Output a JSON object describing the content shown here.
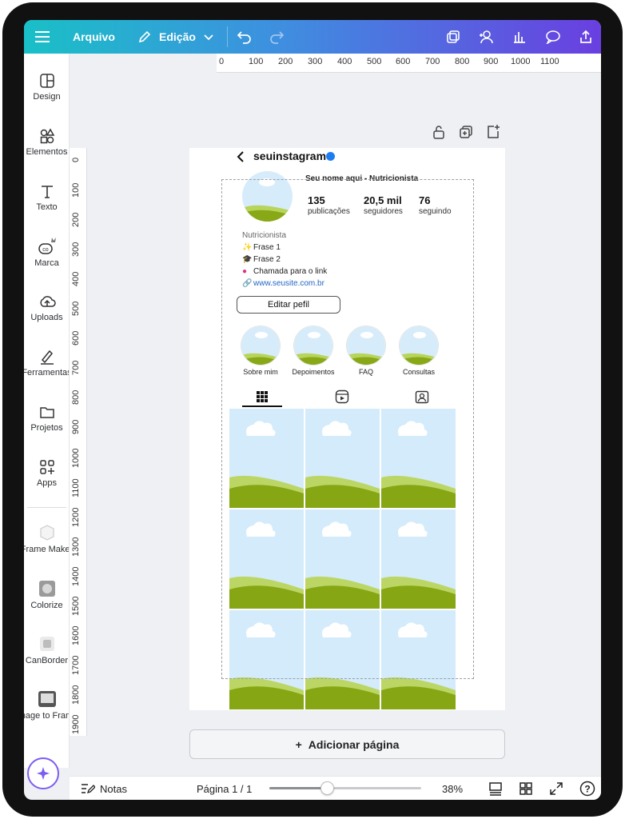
{
  "toolbar": {
    "file_label": "Arquivo",
    "edit_label": "Edição"
  },
  "sidebar": {
    "items": [
      {
        "label": "Design",
        "icon": "layout-icon"
      },
      {
        "label": "Elementos",
        "icon": "shapes-icon"
      },
      {
        "label": "Texto",
        "icon": "text-icon"
      },
      {
        "label": "Marca",
        "icon": "brand-icon"
      },
      {
        "label": "Uploads",
        "icon": "upload-cloud-icon"
      },
      {
        "label": "Ferramentas",
        "icon": "tools-icon"
      },
      {
        "label": "Projetos",
        "icon": "folder-icon"
      },
      {
        "label": "Apps",
        "icon": "apps-icon"
      },
      {
        "label": "Frame Maker",
        "icon": "frame-maker-icon"
      },
      {
        "label": "Colorize",
        "icon": "colorize-icon"
      },
      {
        "label": "CanBorder",
        "icon": "canborder-icon"
      },
      {
        "label": "Image to Frame",
        "icon": "image-to-frame-icon"
      }
    ]
  },
  "ruler": {
    "top": [
      "0",
      "100",
      "200",
      "300",
      "400",
      "500",
      "600",
      "700",
      "800",
      "900",
      "1000",
      "1100"
    ],
    "left": [
      "0",
      "100",
      "200",
      "300",
      "400",
      "500",
      "600",
      "700",
      "800",
      "900",
      "1000",
      "1100",
      "1200",
      "1300",
      "1400",
      "1500",
      "1600",
      "1700",
      "1800",
      "1900"
    ]
  },
  "profile": {
    "username": "seuinstagram",
    "name_line": "Seu nome aqui - Nutricionista",
    "stats": [
      {
        "value": "135",
        "label": "publicações"
      },
      {
        "value": "20,5 mil",
        "label": "seguidores"
      },
      {
        "value": "76",
        "label": "seguindo"
      }
    ],
    "bio": {
      "role": "Nutricionista",
      "line1": "Frase 1",
      "line2": "Frase 2",
      "line3": "Chamada para o link",
      "link": "www.seusite.com.br"
    },
    "edit_button": "Editar pefil",
    "highlights": [
      "Sobre mim",
      "Depoimentos",
      "FAQ",
      "Consultas"
    ]
  },
  "bottom": {
    "add_page": "Adicionar página",
    "notes": "Notas",
    "page_indicator": "Página 1 / 1",
    "zoom": "38%",
    "zoom_fraction": 0.38
  },
  "colors": {
    "accent": "#7d5cf0",
    "verified": "#1e7cf2",
    "link": "#2267c7",
    "sky": "#cfe9fb",
    "grass": "#8aab1a"
  }
}
